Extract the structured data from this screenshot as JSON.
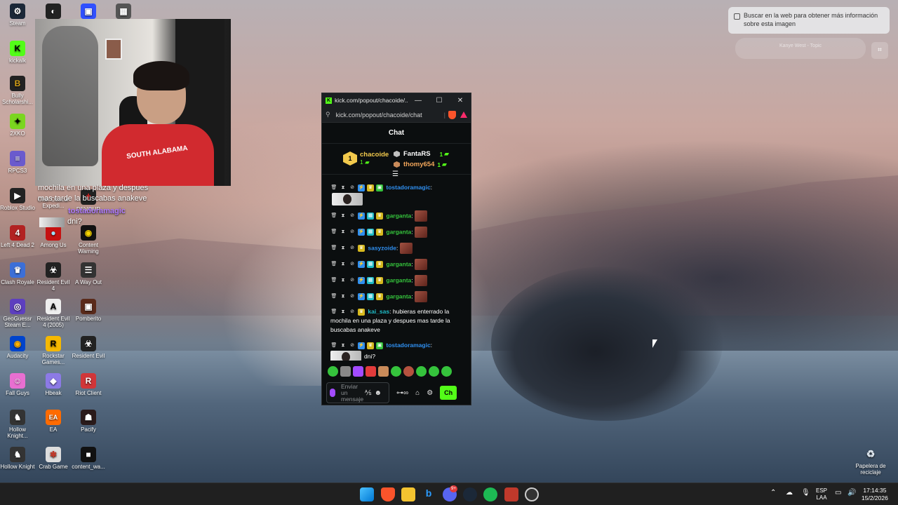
{
  "desktop": {
    "icons": [
      {
        "label": "Steam",
        "x_col": 0,
        "glyph": "⚙",
        "color": "#1b2838"
      },
      {
        "label": "kickalk",
        "glyph": "K",
        "color": "#53fc18"
      },
      {
        "label": "Bully Scholarshi...",
        "glyph": "B",
        "color": "#d4a017"
      },
      {
        "label": "2XKO",
        "glyph": "✦",
        "color": "#7ad61f"
      },
      {
        "label": "RPCS3",
        "glyph": "≡",
        "color": "#6a5acd"
      },
      {
        "label": "Roblox Studio",
        "glyph": "▶",
        "color": "#222"
      },
      {
        "label": "Left 4 Dead 2",
        "glyph": "4",
        "color": "#b22222"
      },
      {
        "label": "Clash Royale",
        "glyph": "♛",
        "color": "#3b6fd8"
      },
      {
        "label": "GeoGuessr Steam E...",
        "glyph": "◎",
        "color": "#5d3fbf"
      },
      {
        "label": "Audacity",
        "glyph": "◉",
        "color": "#0044cc"
      },
      {
        "label": "Fall Guys",
        "glyph": "☺",
        "color": "#e86fd1"
      },
      {
        "label": "Hollow Knight...",
        "glyph": "♞",
        "color": "#333"
      },
      {
        "label": "Hollow Knight",
        "glyph": "♞",
        "color": "#333"
      },
      {
        "label": "Clair Obscur Expedi...",
        "glyph": "✧",
        "color": "#444"
      },
      {
        "label": "Among Us",
        "glyph": "●",
        "color": "#c51111"
      },
      {
        "label": "Resident Evil 4",
        "glyph": "☣",
        "color": "#222"
      },
      {
        "label": "Resident Evil 4 (2005)",
        "glyph": "A",
        "color": "#eee"
      },
      {
        "label": "Rockstar Games...",
        "glyph": "R",
        "color": "#f5b800"
      },
      {
        "label": "Hbeak",
        "glyph": "◆",
        "color": "#8c7ae6"
      },
      {
        "label": "EA",
        "glyph": "EA",
        "color": "#ff6b00"
      },
      {
        "label": "Crab Game",
        "glyph": "🦀",
        "color": "#ddd"
      },
      {
        "label": "DEVOUR",
        "glyph": "✝",
        "color": "#222"
      },
      {
        "label": "Content Warning",
        "glyph": "◉",
        "color": "#111"
      },
      {
        "label": "A Way Out",
        "glyph": "☰",
        "color": "#333"
      },
      {
        "label": "Pomberito",
        "glyph": "▣",
        "color": "#5a2a1a"
      },
      {
        "label": "Resident Evil",
        "glyph": "☣",
        "color": "#222"
      },
      {
        "label": "Riot Client",
        "glyph": "R",
        "color": "#d13639"
      },
      {
        "label": "Pacify",
        "glyph": "☗",
        "color": "#2a1a1a"
      },
      {
        "label": "content_wa...",
        "glyph": "■",
        "color": "#111"
      },
      {
        "label": "Papelera de reciclaje",
        "glyph": "♻",
        "color": "transparent"
      }
    ],
    "overlay_chat": {
      "line1": "mochila en una plaza y despues",
      "line2": "mas tarde la buscabas anakeve",
      "user": "tostadoramagic",
      "msg": "dni?"
    },
    "webcam_shirt": "SOUTH ALABAMA"
  },
  "browser": {
    "window_title": "kick.com/popout/chacoide/...",
    "url": "kick.com/popout/chacoide/chat",
    "chat_title": "Chat",
    "leaderboard": {
      "first": {
        "rank": "1",
        "name": "chacoide",
        "count": "1"
      },
      "second": {
        "name": "FantaRS",
        "count": "1"
      },
      "third": {
        "name": "thomy654",
        "count": "1"
      }
    },
    "messages": [
      {
        "user": "tostadoramagic",
        "color": "#2f8ff0",
        "text": "",
        "has_avatar_pic": true
      },
      {
        "user": "garganta",
        "color": "#35c33c",
        "text": "",
        "emote": true
      },
      {
        "user": "garganta",
        "color": "#35c33c",
        "text": "",
        "emote": true
      },
      {
        "user": "sasyzoide",
        "color": "#2f8ff0",
        "text": "",
        "emote": true
      },
      {
        "user": "garganta",
        "color": "#35c33c",
        "text": "",
        "emote": true
      },
      {
        "user": "garganta",
        "color": "#35c33c",
        "text": "",
        "emote": true
      },
      {
        "user": "garganta",
        "color": "#35c33c",
        "text": "",
        "emote": true
      },
      {
        "user": "kai_sas",
        "color": "#1fbcc7",
        "text": "hubieras enterrado la mochila en una plaza y despues mas tarde la buscabas anakeve"
      },
      {
        "user": "tostadoramagic",
        "color": "#2f8ff0",
        "text": "dni?",
        "has_avatar_pic": true
      }
    ],
    "input_placeholder": "Enviar un mensaje",
    "chat_button": "Ch"
  },
  "lens": {
    "text": "Buscar en la web para obtener más información sobre esta imagen",
    "music_pill": "Kanye West - Topic"
  },
  "taskbar": {
    "lang": "ESP",
    "lang_sub": "LAA",
    "time": "17:14:35",
    "date": "15/2/2026",
    "discord_badge": "9+"
  }
}
